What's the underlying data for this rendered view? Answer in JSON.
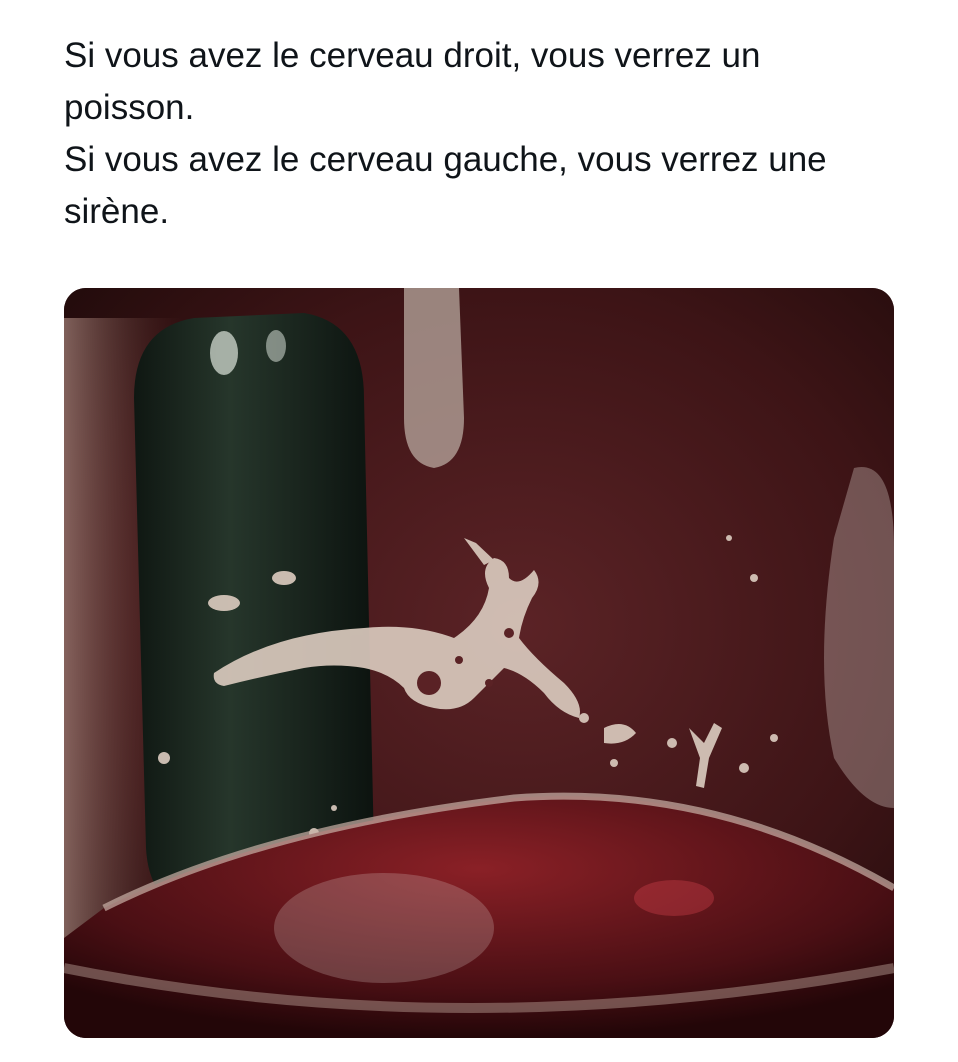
{
  "tweet": {
    "lines": [
      "Si vous avez le cerveau droit, vous verrez un",
      "poisson.",
      "Si vous avez le cerveau gauche, vous verrez une",
      "sirène."
    ]
  },
  "media": {
    "subject": "glass-of-red-wine-with-foam-shape",
    "colors": {
      "wine": "#5a1a1e",
      "bottle": "#1c2a22",
      "foam": "#d9c9bd"
    }
  }
}
